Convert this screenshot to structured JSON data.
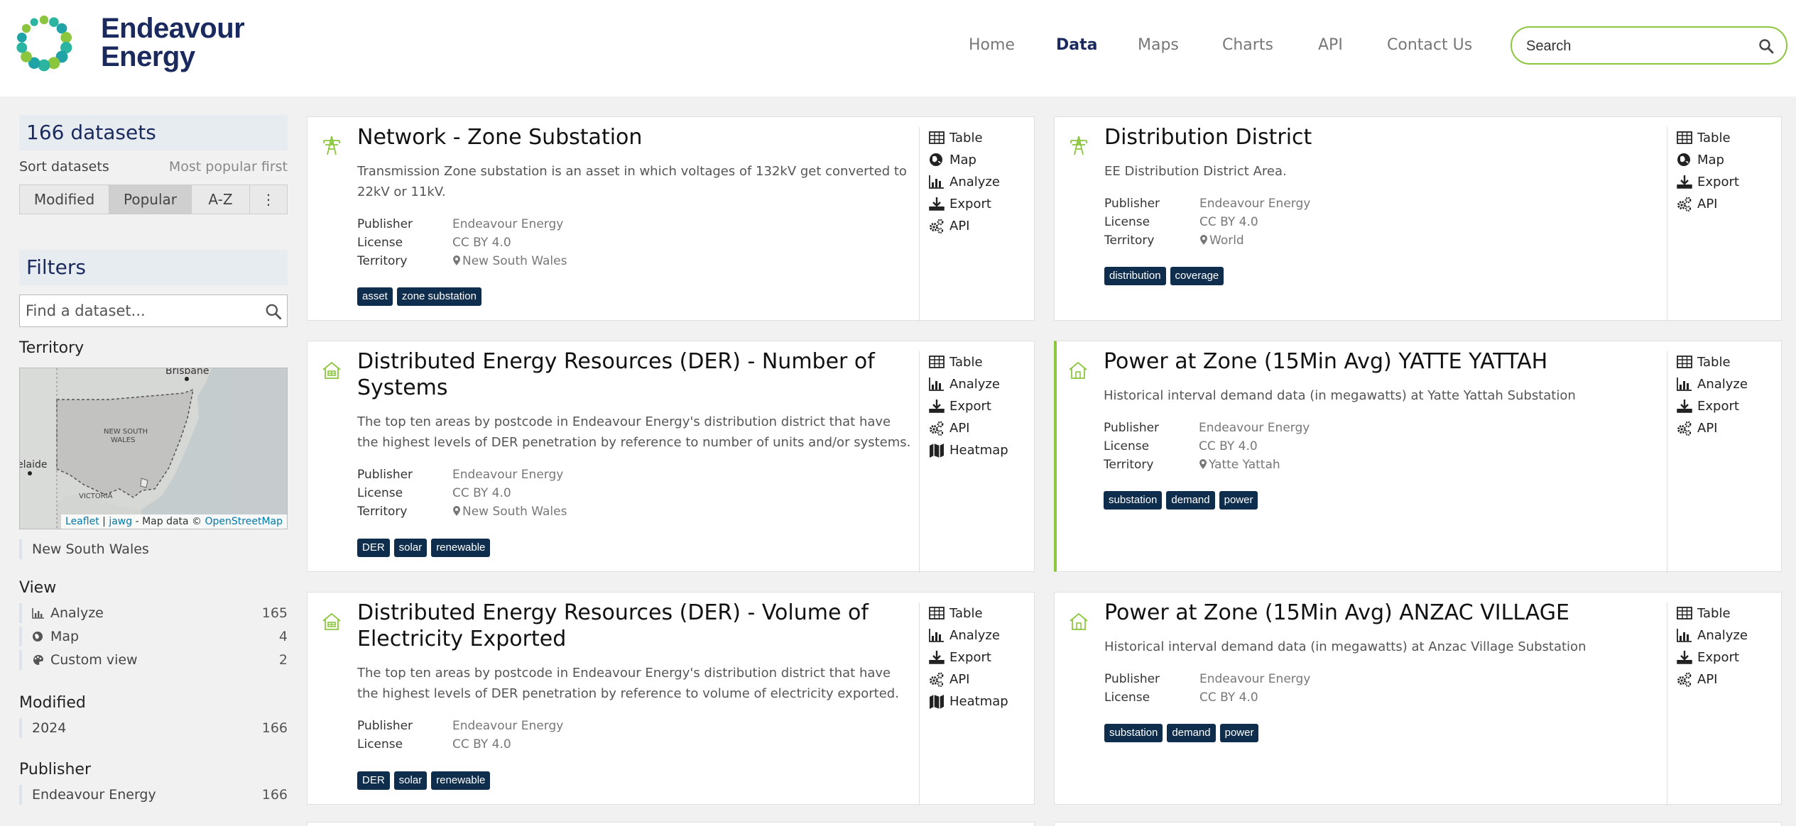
{
  "header": {
    "logo_line1": "Endeavour",
    "logo_line2": "Energy",
    "nav": [
      {
        "label": "Home",
        "active": false
      },
      {
        "label": "Data",
        "active": true
      },
      {
        "label": "Maps",
        "active": false
      },
      {
        "label": "Charts",
        "active": false
      },
      {
        "label": "API",
        "active": false
      },
      {
        "label": "Contact Us",
        "active": false
      }
    ],
    "search_placeholder": "Search"
  },
  "sidebar": {
    "dataset_count": "166 datasets",
    "sort_label": "Sort datasets",
    "sort_value": "Most popular first",
    "sort_options": [
      "Modified",
      "Popular",
      "A-Z",
      "⋮"
    ],
    "sort_active": "Popular",
    "filters_title": "Filters",
    "find_placeholder": "Find a dataset...",
    "territory_head": "Territory",
    "map_labels": {
      "brisbane": "Brisbane",
      "nsw": "NEW SOUTH\nWALES",
      "victoria": "VICTORIA",
      "adelaide": "elaide"
    },
    "map_attr": {
      "leaflet": "Leaflet",
      "sep": " | ",
      "jawg": "jawg",
      "mid": " - Map data © ",
      "osm": "OpenStreetMap"
    },
    "territory_items": [
      {
        "label": "New South Wales"
      }
    ],
    "view_head": "View",
    "view_items": [
      {
        "label": "Analyze",
        "count": "165",
        "icon": "bar-chart-icon"
      },
      {
        "label": "Map",
        "count": "4",
        "icon": "globe-icon"
      },
      {
        "label": "Custom view",
        "count": "2",
        "icon": "palette-icon"
      }
    ],
    "modified_head": "Modified",
    "modified_items": [
      {
        "label": "2024",
        "count": "166"
      }
    ],
    "publisher_head": "Publisher",
    "publisher_items": [
      {
        "label": "Endeavour Energy",
        "count": "166"
      }
    ]
  },
  "labels": {
    "publisher": "Publisher",
    "license": "License",
    "territory": "Territory"
  },
  "cards": [
    {
      "title": "Network - Zone Substation",
      "desc": [
        "Transmission Zone substation is an asset in which voltages of 132kV get converted to",
        "22kV or 11kV."
      ],
      "publisher": "Endeavour Energy",
      "license": "CC BY 4.0",
      "territory": "New South Wales",
      "tags": [
        "asset",
        "zone substation"
      ],
      "actions": [
        "Table",
        "Map",
        "Analyze",
        "Export",
        "API"
      ],
      "icon": "transmission-tower-icon"
    },
    {
      "title": "Distribution District",
      "desc": [
        "EE Distribution District Area."
      ],
      "publisher": "Endeavour Energy",
      "license": "CC BY 4.0",
      "territory": "World",
      "tags": [
        "distribution",
        "coverage"
      ],
      "actions": [
        "Table",
        "Map",
        "Export",
        "API"
      ],
      "icon": "transmission-tower-icon"
    },
    {
      "title_lines": [
        "Distributed Energy Resources (DER) - Number of",
        "Systems"
      ],
      "desc": [
        "The top ten areas by postcode in Endeavour Energy's distribution district that have",
        "the highest levels of DER penetration by reference to number of units and/or systems."
      ],
      "publisher": "Endeavour Energy",
      "license": "CC BY 4.0",
      "territory": "New South Wales",
      "tags": [
        "DER",
        "solar",
        "renewable"
      ],
      "actions": [
        "Table",
        "Analyze",
        "Export",
        "API",
        "Heatmap"
      ],
      "icon": "solar-house-icon"
    },
    {
      "title": "Power at Zone (15Min Avg) YATTE YATTAH",
      "desc": [
        "Historical interval demand data (in megawatts) at Yatte Yattah Substation"
      ],
      "publisher": "Endeavour Energy",
      "license": "CC BY 4.0",
      "territory": "Yatte Yattah",
      "tags": [
        "substation",
        "demand",
        "power"
      ],
      "actions": [
        "Table",
        "Analyze",
        "Export",
        "API"
      ],
      "icon": "house-icon"
    },
    {
      "title_lines": [
        "Distributed Energy Resources (DER) - Volume of",
        "Electricity Exported"
      ],
      "desc": [
        "The top ten areas by postcode in Endeavour Energy's distribution district that have",
        "the highest levels of DER penetration by reference to volume of electricity exported."
      ],
      "publisher": "Endeavour Energy",
      "license": "CC BY 4.0",
      "tags": [
        "DER",
        "solar",
        "renewable"
      ],
      "actions": [
        "Table",
        "Analyze",
        "Export",
        "API",
        "Heatmap"
      ],
      "icon": "solar-house-icon"
    },
    {
      "title": "Power at Zone (15Min Avg) ANZAC VILLAGE",
      "desc": [
        "Historical interval demand data (in megawatts) at Anzac Village Substation"
      ],
      "publisher": "Endeavour Energy",
      "license": "CC BY 4.0",
      "tags": [
        "substation",
        "demand",
        "power"
      ],
      "actions": [
        "Table",
        "Analyze",
        "Export",
        "API"
      ],
      "icon": "house-icon"
    }
  ],
  "colors": {
    "brand_navy": "#1b2a5e",
    "brand_green": "#8cc63f",
    "tag_bg": "#0f2e4e"
  }
}
